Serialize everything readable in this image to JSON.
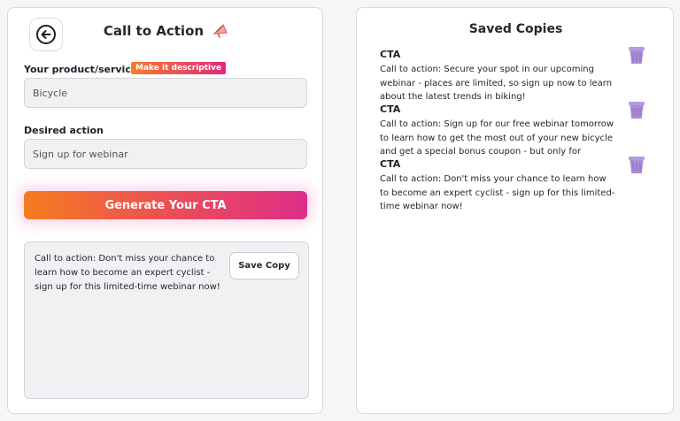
{
  "left_panel": {
    "title": "Call to Action",
    "product_label": "Your product/service",
    "descriptive_badge": "Make it descriptive",
    "product_value": "Bicycle",
    "action_label": "Desired action",
    "action_value": "Sign up for webinar",
    "generate_button": "Generate Your CTA",
    "output_text": "Call to action: Don't miss your chance to learn how to become an expert cyclist - sign up for this limited-time webinar now!",
    "save_button": "Save Copy"
  },
  "right_panel": {
    "title": "Saved Copies",
    "items": [
      {
        "heading": "CTA",
        "text": "Call to action: Secure your spot in our upcoming webinar - places are limited, so sign up now to learn about the latest trends in biking!"
      },
      {
        "heading": "CTA",
        "text": "Call to action: Sign up for our free webinar tomorrow to learn how to get the most out of your new bicycle and get a special bonus coupon - but only for"
      },
      {
        "heading": "CTA",
        "text": "Call to action: Don't miss your chance to learn how to become an expert cyclist - sign up for this limited-time webinar now!"
      }
    ]
  },
  "icons": {
    "back": "arrow-left-icon",
    "title": "megaphone-icon",
    "delete": "trash-icon"
  },
  "colors": {
    "gradient_start": "#f57c1f",
    "gradient_end": "#dc2f88",
    "trash": "#a98bd6"
  }
}
